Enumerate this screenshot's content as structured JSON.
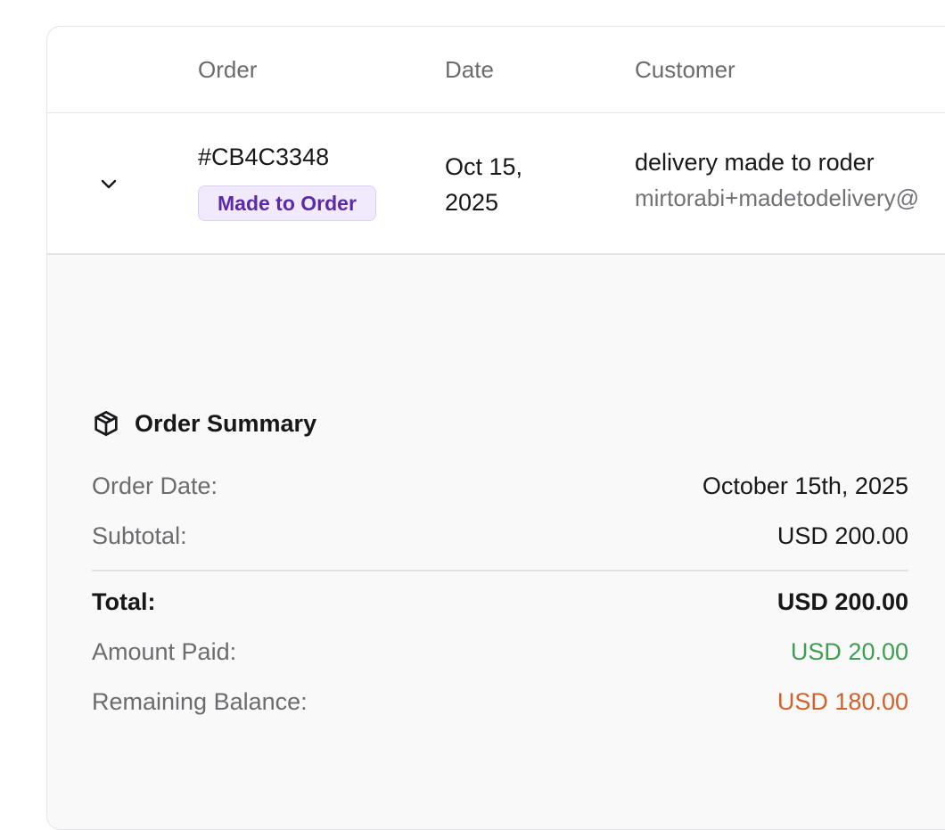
{
  "table": {
    "headers": {
      "order": "Order",
      "date": "Date",
      "customer": "Customer"
    },
    "row": {
      "order_id": "#CB4C3348",
      "badge": "Made to Order",
      "date": "Oct 15, 2025",
      "customer_name": "delivery made to roder",
      "customer_email": "mirtorabi+madetodelivery@"
    }
  },
  "summary": {
    "title": "Order Summary",
    "icon": "package-icon",
    "order_date_label": "Order Date:",
    "order_date_value": "October 15th, 2025",
    "subtotal_label": "Subtotal:",
    "subtotal_value": "USD 200.00",
    "total_label": "Total:",
    "total_value": "USD 200.00",
    "amount_paid_label": "Amount Paid:",
    "amount_paid_value": "USD 20.00",
    "remaining_label": "Remaining Balance:",
    "remaining_value": "USD 180.00"
  },
  "colors": {
    "badge_text": "#5b2aa8",
    "badge_bg": "#f1eafd",
    "paid_green": "#3f9e4f",
    "remaining_orange": "#d4602a"
  }
}
